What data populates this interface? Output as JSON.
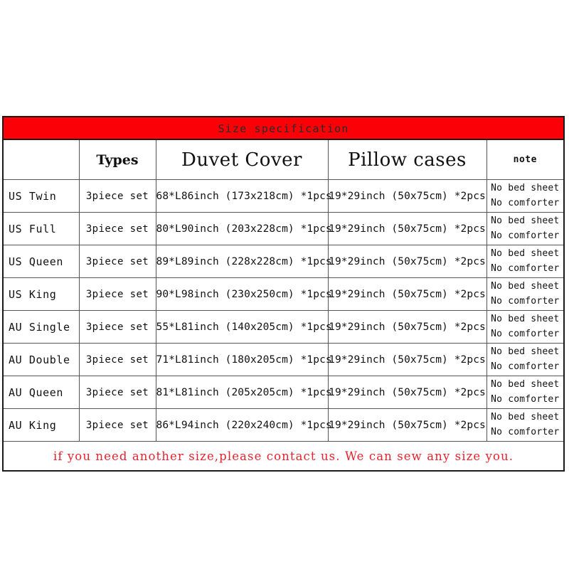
{
  "table": {
    "title": "Size specification",
    "title_bg": "#fb0007",
    "shaded_row_bg": "#c8c8c8",
    "footer_color": "#e8222c",
    "headers": {
      "blank": "",
      "types": "Types",
      "duvet": "Duvet Cover",
      "pillow": "Pillow cases",
      "note": "note"
    },
    "rows": [
      {
        "size": "US Twin",
        "set": "3piece set",
        "duvet": "68*L86inch (173x218cm) *1pcs",
        "pillow": "19*29inch (50x75cm) *2pcs",
        "note_line1": "No bed sheet",
        "note_line2": "No comforter",
        "shaded": true
      },
      {
        "size": "US Full",
        "set": "3piece set",
        "duvet": "80*L90inch (203x228cm) *1pcs",
        "pillow": "19*29inch (50x75cm) *2pcs",
        "note_line1": "No bed sheet",
        "note_line2": "No comforter",
        "shaded": true
      },
      {
        "size": "US Queen",
        "set": "3piece set",
        "duvet": "89*L89inch (228x228cm) *1pcs",
        "pillow": "19*29inch (50x75cm) *2pcs",
        "note_line1": "No bed sheet",
        "note_line2": "No comforter",
        "shaded": true
      },
      {
        "size": "US King",
        "set": "3piece set",
        "duvet": "90*L98inch (230x250cm) *1pcs",
        "pillow": "19*29inch (50x75cm) *2pcs",
        "note_line1": "No bed sheet",
        "note_line2": "No comforter",
        "shaded": true
      },
      {
        "size": "AU Single",
        "set": "3piece set",
        "duvet": "55*L81inch (140x205cm) *1pcs",
        "pillow": "19*29inch (50x75cm) *2pcs",
        "note_line1": "No bed sheet",
        "note_line2": "No comforter",
        "shaded": false
      },
      {
        "size": "AU Double",
        "set": "3piece set",
        "duvet": "71*L81inch (180x205cm) *1pcs",
        "pillow": "19*29inch (50x75cm) *2pcs",
        "note_line1": "No bed sheet",
        "note_line2": "No comforter",
        "shaded": false
      },
      {
        "size": "AU Queen",
        "set": "3piece set",
        "duvet": "81*L81inch (205x205cm) *1pcs",
        "pillow": "19*29inch (50x75cm) *2pcs",
        "note_line1": "No bed sheet",
        "note_line2": "No comforter",
        "shaded": false
      },
      {
        "size": "AU King",
        "set": "3piece set",
        "duvet": "86*L94inch (220x240cm) *1pcs",
        "pillow": "19*29inch (50x75cm) *2pcs",
        "note_line1": "No bed sheet",
        "note_line2": "No comforter",
        "shaded": false
      }
    ],
    "footer": "if you need another size,please contact us. We can sew any size you."
  }
}
